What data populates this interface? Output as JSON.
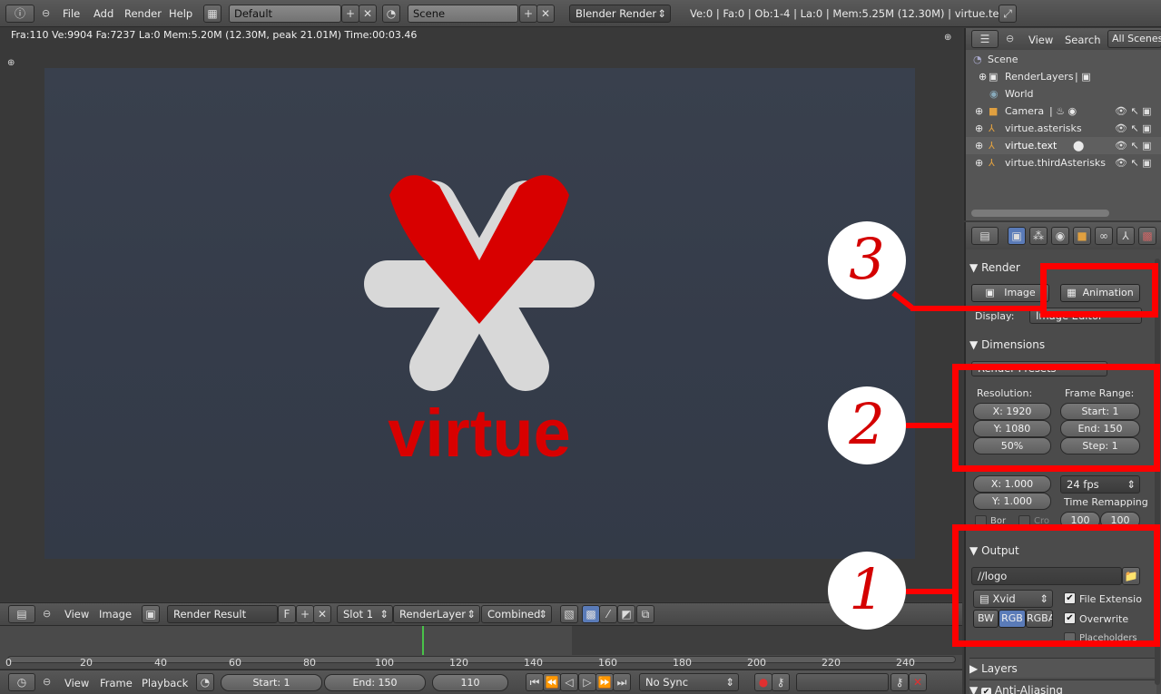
{
  "topbar": {
    "menus": [
      "File",
      "Add",
      "Render",
      "Help"
    ],
    "layout": "Default",
    "scene": "Scene",
    "engine": "Blender Render",
    "stats": "Ve:0 | Fa:0 | Ob:1-4 | La:0 | Mem:5.25M (12.30M) | virtue.text"
  },
  "viewport": {
    "status": "Fra:110  Ve:9904 Fa:7237 La:0 Mem:5.20M (12.30M, peak 21.01M) Time:00:03.46",
    "logo_text": "virtue"
  },
  "image_header": {
    "view": "View",
    "image": "Image",
    "render_result": "Render Result",
    "f_label": "F",
    "slot": "Slot 1",
    "layer": "RenderLayer",
    "pass": "Combined"
  },
  "timeline": {
    "ticks": [
      "0",
      "20",
      "40",
      "60",
      "80",
      "100",
      "120",
      "140",
      "160",
      "180",
      "200",
      "220",
      "240"
    ],
    "current_frame": 110
  },
  "timeline_header": {
    "view": "View",
    "frame": "Frame",
    "playback": "Playback",
    "start": "Start: 1",
    "end": "End: 150",
    "current": "110",
    "sync": "No Sync"
  },
  "outliner": {
    "view": "View",
    "search": "Search",
    "filter": "All Scenes",
    "items": [
      "Scene",
      "RenderLayers",
      "World",
      "Camera",
      "virtue.asterisks",
      "virtue.text",
      "virtue.thirdAsterisks"
    ]
  },
  "properties": {
    "render": {
      "title": "Render",
      "image_btn": "Image",
      "animation_btn": "Animation",
      "display_label": "Display:",
      "display_value": "Image Editor"
    },
    "dimensions": {
      "title": "Dimensions",
      "presets": "Render Presets",
      "resolution_label": "Resolution:",
      "res_x": "X: 1920",
      "res_y": "Y: 1080",
      "res_pct": "50%",
      "frame_range_label": "Frame Range:",
      "start": "Start: 1",
      "end": "End: 150",
      "step": "Step: 1",
      "aspect_x": "X: 1.000",
      "aspect_y": "Y: 1.000",
      "fps": "24 fps",
      "time_remap": "Time Remapping",
      "remap_old": "100",
      "remap_new": "100",
      "border": "Bor",
      "crop": "Cro"
    },
    "output": {
      "title": "Output",
      "path": "//logo",
      "format": "Xvid",
      "bw": "BW",
      "rgb": "RGB",
      "rgba": "RGBA",
      "file_ext": "File Extensio",
      "overwrite": "Overwrite",
      "placeholders": "Placeholders"
    },
    "layers": {
      "title": "Layers"
    },
    "antialiasing": {
      "title": "Anti-Aliasing"
    }
  },
  "annotations": [
    "1",
    "2",
    "3"
  ],
  "colors": {
    "accent_red": "#ff0000",
    "logo_red": "#d80000",
    "asterisk_white": "#dcdcdc"
  }
}
